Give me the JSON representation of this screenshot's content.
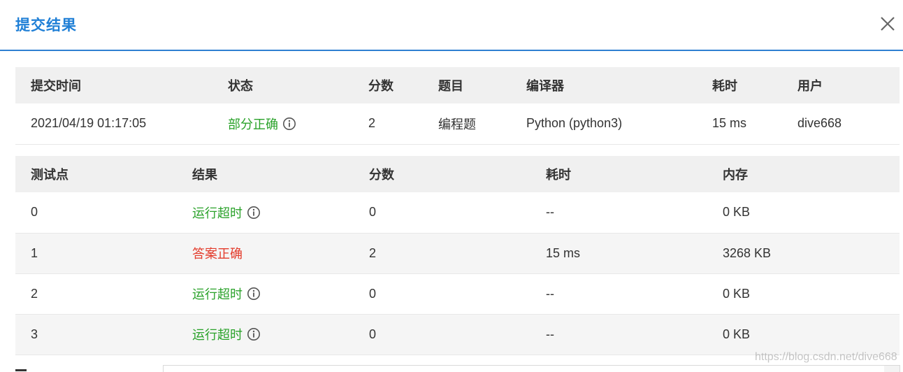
{
  "dialog": {
    "title": "提交结果",
    "close_icon": "close-icon"
  },
  "submission": {
    "headers": {
      "time": "提交时间",
      "status": "状态",
      "score": "分数",
      "problem": "题目",
      "compiler": "编译器",
      "elapsed": "耗时",
      "user": "用户"
    },
    "row": {
      "time": "2021/04/19 01:17:05",
      "status": "部分正确",
      "score": "2",
      "problem": "编程题",
      "compiler": "Python (python3)",
      "elapsed": "15 ms",
      "user": "dive668"
    },
    "status_icon": "info-icon",
    "status_color": "#2aa22a"
  },
  "testcases": {
    "headers": {
      "case": "测试点",
      "result": "结果",
      "score": "分数",
      "elapsed": "耗时",
      "memory": "内存"
    },
    "rows": [
      {
        "case": "0",
        "result": "运行超时",
        "score": "0",
        "elapsed": "--",
        "memory": "0 KB"
      },
      {
        "case": "1",
        "result": "答案正确",
        "score": "2",
        "elapsed": "15 ms",
        "memory": "3268 KB"
      },
      {
        "case": "2",
        "result": "运行超时",
        "score": "0",
        "elapsed": "--",
        "memory": "0 KB"
      },
      {
        "case": "3",
        "result": "运行超时",
        "score": "0",
        "elapsed": "--",
        "memory": "0 KB"
      }
    ],
    "colors": {
      "timeout": "#2aa22a",
      "accepted": "#e33b2b"
    }
  },
  "watermark": "https://blog.csdn.net/dive668"
}
